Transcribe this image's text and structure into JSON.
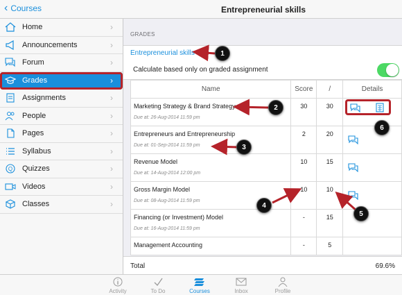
{
  "topbar": {
    "back_label": "Courses",
    "title": "Entrepreneurial skills"
  },
  "sidebar": {
    "items": [
      {
        "label": "Home",
        "icon": "home-icon"
      },
      {
        "label": "Announcements",
        "icon": "megaphone-icon"
      },
      {
        "label": "Forum",
        "icon": "chat-icon"
      },
      {
        "label": "Grades",
        "icon": "grades-icon",
        "active": true
      },
      {
        "label": "Assignments",
        "icon": "assignment-icon"
      },
      {
        "label": "People",
        "icon": "people-icon"
      },
      {
        "label": "Pages",
        "icon": "pages-icon"
      },
      {
        "label": "Syllabus",
        "icon": "syllabus-icon"
      },
      {
        "label": "Quizzes",
        "icon": "quiz-icon"
      },
      {
        "label": "Videos",
        "icon": "video-icon"
      },
      {
        "label": "Classes",
        "icon": "classes-icon"
      }
    ]
  },
  "main": {
    "section_header": "GRADES",
    "course_link": "Entrepreneurial skills",
    "calc_label": "Calculate based only on graded assignment",
    "calc_toggle_on": true,
    "table": {
      "headers": {
        "name": "Name",
        "score": "Score",
        "slash": "/",
        "details": "Details"
      },
      "rows": [
        {
          "title": "Marketing Strategy & Brand Strategy",
          "due": "Due at: 26-Aug-2014 11:59 pm",
          "score": "30",
          "points": "30"
        },
        {
          "title": "Entrepreneurs and Entrepreneurship",
          "due": "Due at: 01-Sep-2014 11:59 pm",
          "score": "2",
          "points": "20"
        },
        {
          "title": "Revenue Model",
          "due": "Due at: 14-Aug-2014 12:00 pm",
          "score": "10",
          "points": "15"
        },
        {
          "title": "Gross Margin Model",
          "due": "Due at: 08-Aug-2014 11:59 pm",
          "score": "10",
          "points": "10"
        },
        {
          "title": "Financing (or Investment) Model",
          "due": "Due at: 16-Aug-2014 11:59 pm",
          "score": "-",
          "points": "15"
        },
        {
          "title": "Management Accounting",
          "due": "",
          "score": "-",
          "points": "5"
        }
      ]
    },
    "total_label": "Total",
    "total_value": "69.6%"
  },
  "tabbar": {
    "items": [
      {
        "label": "Activity",
        "icon": "info-icon"
      },
      {
        "label": "To Do",
        "icon": "checkmark-icon"
      },
      {
        "label": "Courses",
        "icon": "courses-icon",
        "active": true
      },
      {
        "label": "Inbox",
        "icon": "inbox-icon"
      },
      {
        "label": "Profile",
        "icon": "profile-icon"
      }
    ]
  },
  "callouts": [
    "1",
    "2",
    "3",
    "4",
    "5",
    "6"
  ],
  "colors": {
    "accent": "#1a8fdc",
    "highlight": "#b5232a",
    "toggle_on": "#4cd964"
  }
}
